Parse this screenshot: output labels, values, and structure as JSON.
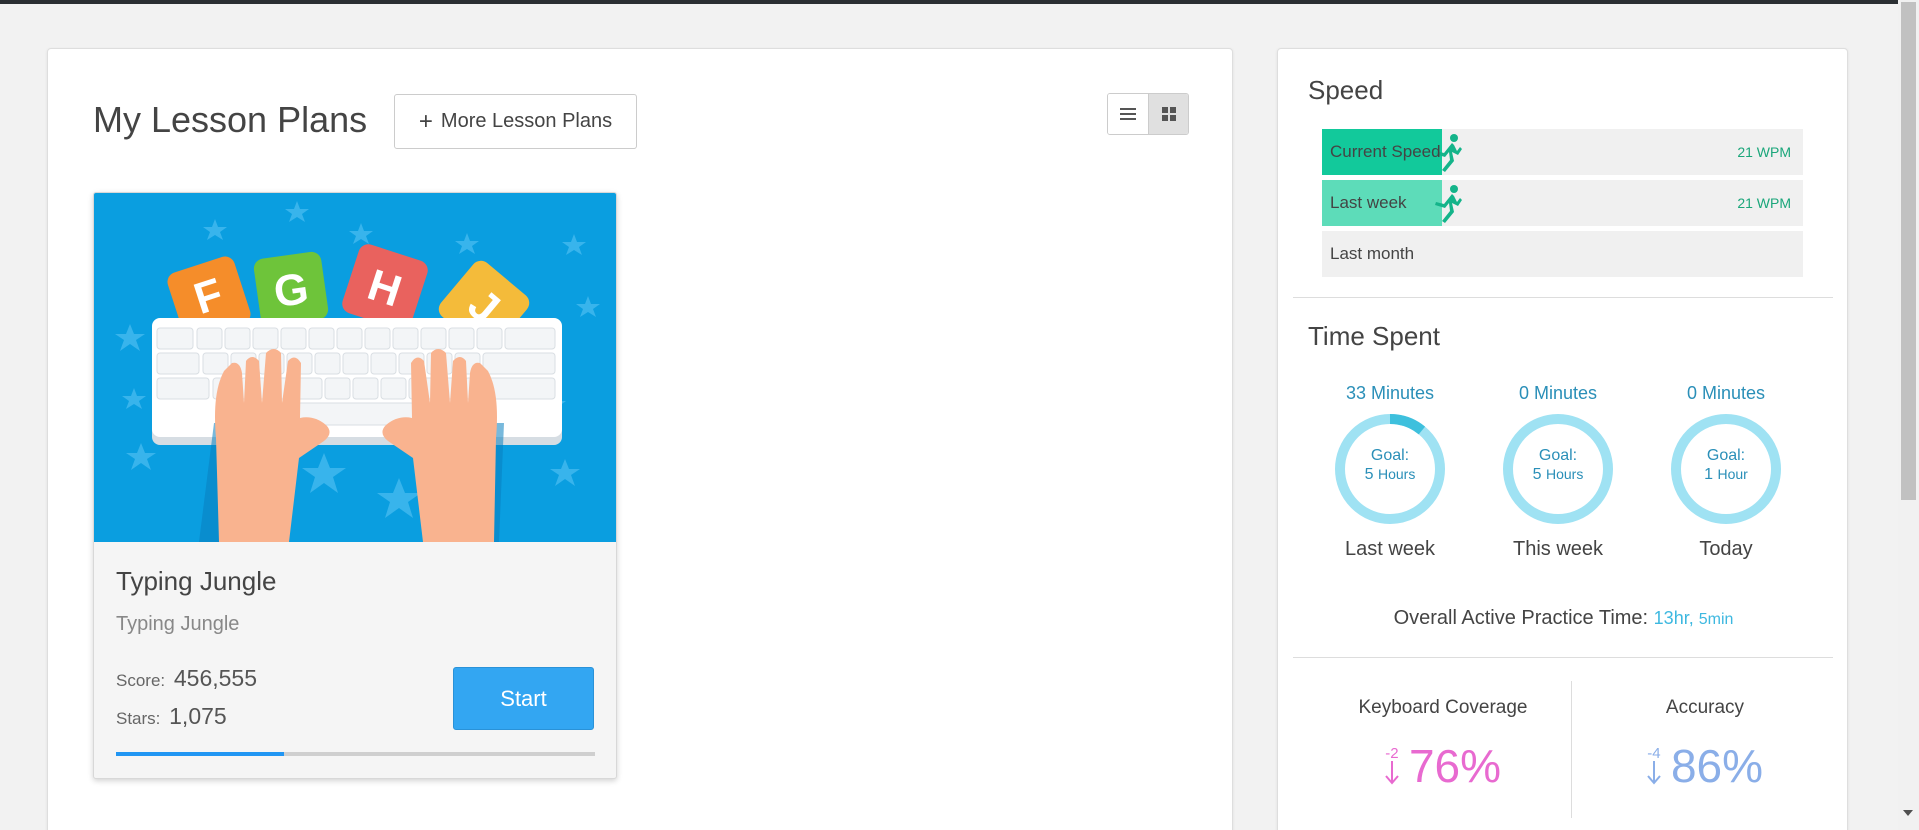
{
  "lesson_plans": {
    "title": "My Lesson Plans",
    "more_button_label": "More Lesson Plans",
    "views": [
      {
        "icon": "list-view-icon",
        "active": false
      },
      {
        "icon": "grid-view-icon",
        "active": true
      }
    ],
    "card": {
      "image_letters": [
        "F",
        "G",
        "H",
        "J"
      ],
      "title": "Typing Jungle",
      "subtitle": "Typing Jungle",
      "score_label": "Score:",
      "score": "456,555",
      "stars_label": "Stars:",
      "stars": "1,075",
      "start_label": "Start",
      "progress_fraction": 0.35
    }
  },
  "stats": {
    "speed": {
      "title": "Speed",
      "rows": [
        {
          "label": "Current Speed",
          "value": "21 WPM",
          "fraction": 0.25,
          "color": "#12c99b"
        },
        {
          "label": "Last week",
          "value": "21 WPM",
          "fraction": 0.25,
          "color": "#5ddcb9"
        },
        {
          "label": "Last month",
          "value": "",
          "fraction": 0,
          "color": "#f0f0f0"
        }
      ]
    },
    "time_spent": {
      "title": "Time Spent",
      "rings": [
        {
          "minutes": "33 Minutes",
          "goal_label": "Goal:",
          "goal_num": "5",
          "goal_unit": "Hours",
          "period": "Last week",
          "fraction": 0.11
        },
        {
          "minutes": "0 Minutes",
          "goal_label": "Goal:",
          "goal_num": "5",
          "goal_unit": "Hours",
          "period": "This week",
          "fraction": 0
        },
        {
          "minutes": "0 Minutes",
          "goal_label": "Goal:",
          "goal_num": "1",
          "goal_unit": "Hour",
          "period": "Today",
          "fraction": 0
        }
      ],
      "overall_label": "Overall Active Practice Time:",
      "overall_hours": "13hr,",
      "overall_minutes": "5min"
    },
    "keyboard_coverage": {
      "label": "Keyboard Coverage",
      "delta": "-2",
      "value": "76%",
      "color": "#e86ad0"
    },
    "accuracy": {
      "label": "Accuracy",
      "delta": "-4",
      "value": "86%",
      "color": "#8aaee8"
    }
  },
  "colors": {
    "accent": "#33a6f2",
    "ring": "#9fe2f3",
    "ring_fill": "#3ec0dd"
  }
}
